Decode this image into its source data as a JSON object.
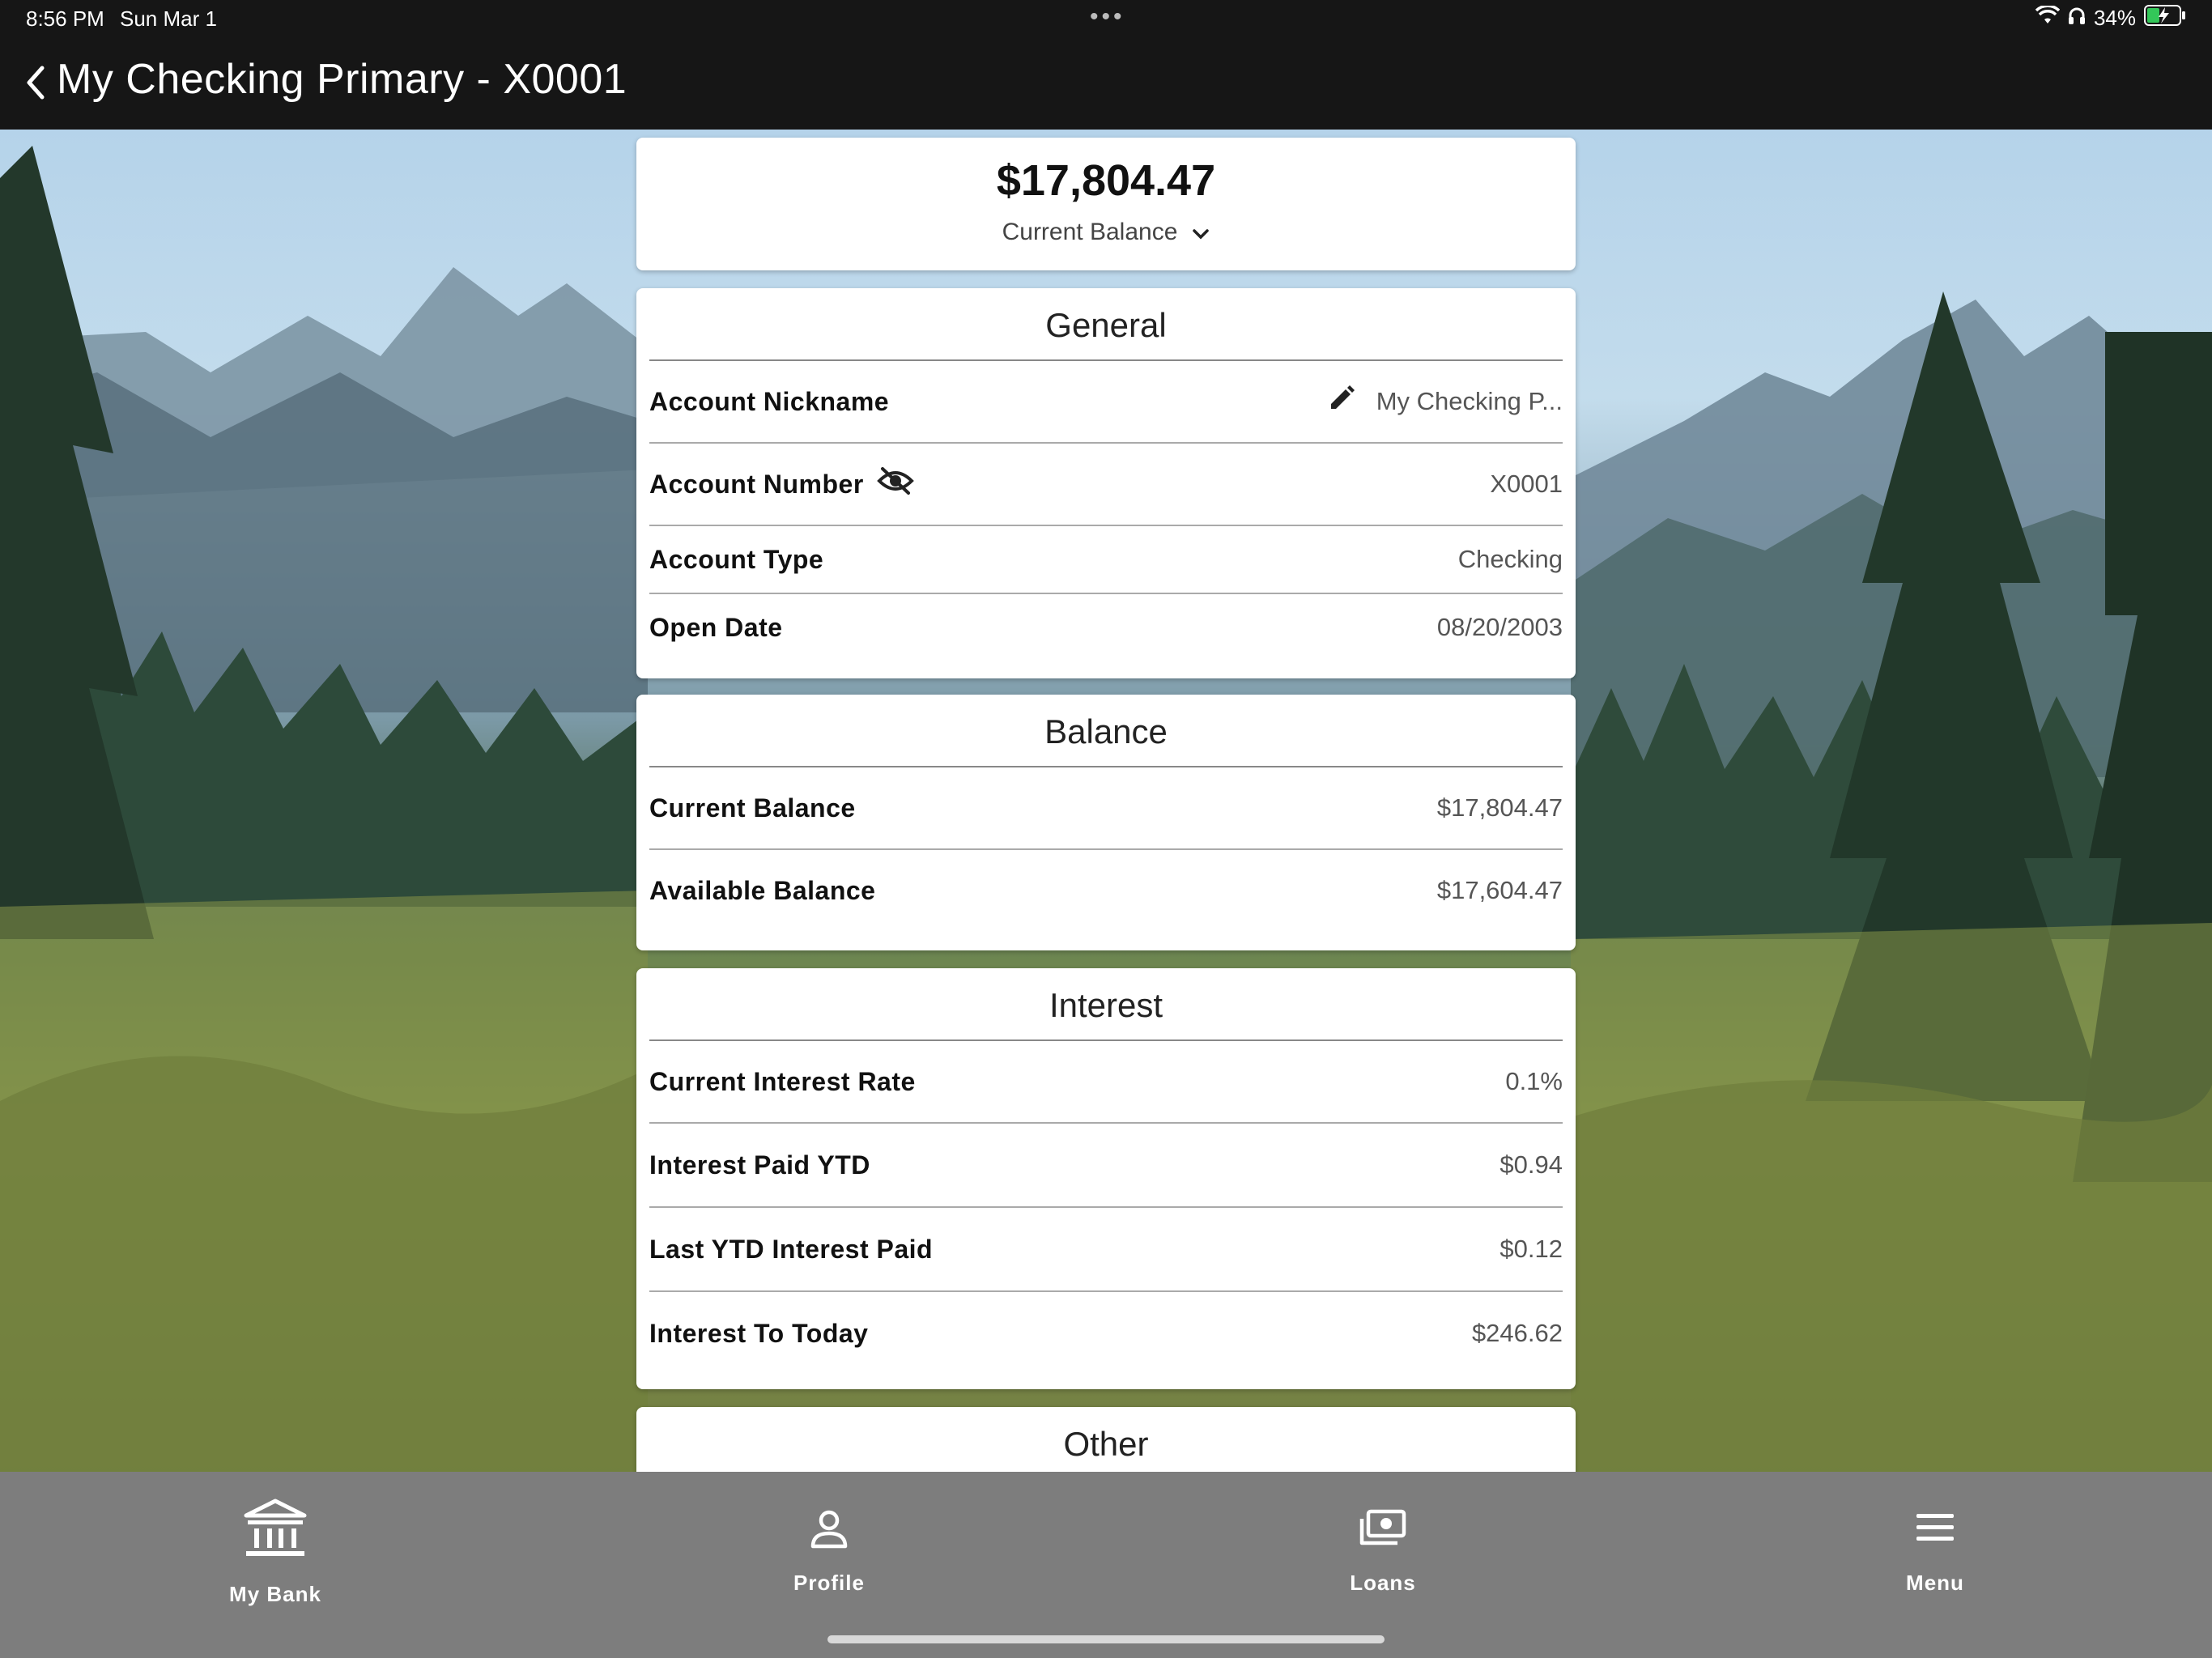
{
  "status_bar": {
    "time": "8:56 PM",
    "date": "Sun Mar 1",
    "battery": "34%",
    "icons": [
      "wifi-icon",
      "headphones-icon",
      "battery-charging-icon"
    ]
  },
  "header": {
    "title": "My Checking Primary - X0001",
    "back_icon": "chevron-left-icon"
  },
  "balance_summary": {
    "amount": "$17,804.47",
    "label": "Current Balance"
  },
  "general": {
    "title": "General",
    "rows": [
      {
        "label": "Account Nickname",
        "value": "My Checking P..."
      },
      {
        "label": "Account Number",
        "value": "X0001"
      },
      {
        "label": "Account Type",
        "value": "Checking"
      },
      {
        "label": "Open Date",
        "value": "08/20/2003"
      }
    ]
  },
  "balance": {
    "title": "Balance",
    "rows": [
      {
        "label": "Current Balance",
        "value": "$17,804.47"
      },
      {
        "label": "Available Balance",
        "value": "$17,604.47"
      }
    ]
  },
  "interest": {
    "title": "Interest",
    "rows": [
      {
        "label": "Current Interest Rate",
        "value": "0.1%"
      },
      {
        "label": "Interest Paid YTD",
        "value": "$0.94"
      },
      {
        "label": "Last YTD Interest Paid",
        "value": "$0.12"
      },
      {
        "label": "Interest To Today",
        "value": "$246.62"
      }
    ]
  },
  "other": {
    "title": "Other"
  },
  "tabbar": {
    "tabs": [
      {
        "label": "My Bank",
        "icon": "bank-icon"
      },
      {
        "label": "Profile",
        "icon": "person-icon"
      },
      {
        "label": "Loans",
        "icon": "money-icon"
      },
      {
        "label": "Menu",
        "icon": "hamburger-menu-icon"
      }
    ]
  },
  "colors": {
    "header_bg": "#161616",
    "tabbar_bg": "#7d7d7d",
    "card_bg": "#ffffff"
  }
}
